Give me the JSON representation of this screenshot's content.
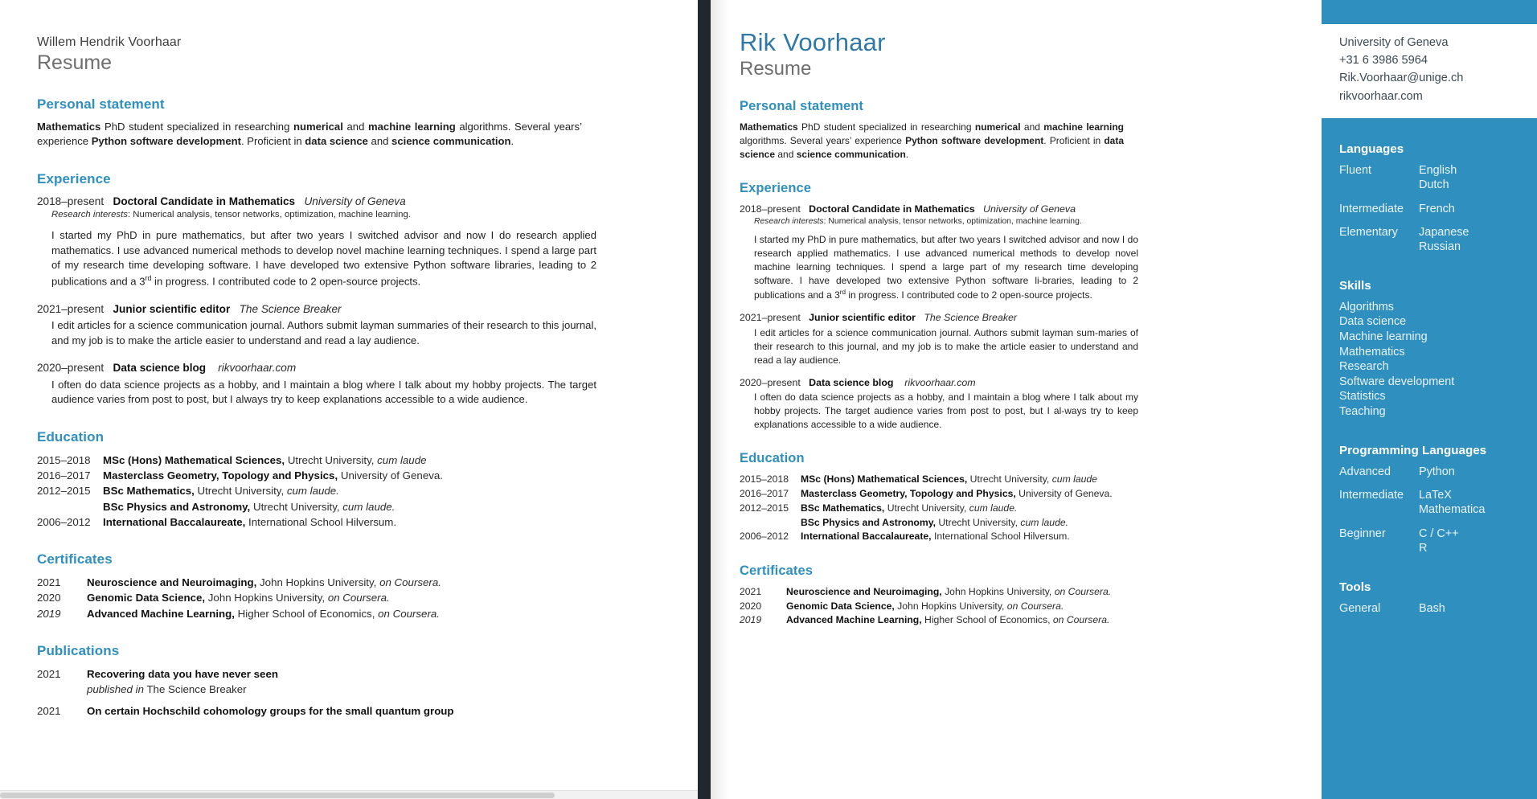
{
  "left_document": {
    "name_line": "Willem Hendrik Voorhaar",
    "title": "Resume",
    "sections": {
      "personal_statement": {
        "heading": "Personal statement",
        "paragraph_parts": [
          {
            "t": "Mathematics",
            "b": true
          },
          {
            "t": " PhD student specialized  in researching ",
            "b": false
          },
          {
            "t": "numerical",
            "b": true
          },
          {
            "t": " and ",
            "b": false
          },
          {
            "t": "machine  learning",
            "b": true
          },
          {
            "t": " algorithms. Several years’ experience ",
            "b": false
          },
          {
            "t": "Python  software  development",
            "b": true
          },
          {
            "t": ". Proficient in ",
            "b": false
          },
          {
            "t": "data science",
            "b": true
          },
          {
            "t": " and ",
            "b": false
          },
          {
            "t": "science communication",
            "b": true
          },
          {
            "t": ".",
            "b": false
          }
        ]
      },
      "experience": {
        "heading": "Experience",
        "entries": [
          {
            "years": "2018–present",
            "title": "Doctoral Candidate in Mathematics",
            "org": "University of Geneva",
            "meta_label": "Research interests",
            "meta_text": ": Numerical analysis, tensor networks, optimization, machine learning.",
            "body_1": "I started my PhD in pure mathematics, but after two years I switched advisor and now I do research applied mathematics. I use advanced numerical methods to develop  novel machine learning techniques. I spend a large part of my research time developing  software. I have developed  two extensive Python software libraries, leading to 2 publications and a 3",
            "body_sup": "rd",
            "body_2": " in progress. I contributed code to 2 open-source projects."
          },
          {
            "years": "2021–present",
            "title": "Junior scientific editor",
            "org": "The Science Breaker",
            "body_1": "I edit articles for a science communication journal. Authors submit layman summaries of their  research to this journal, and my job is to make the article easier to understand and read a lay audience."
          },
          {
            "years": "2020–present",
            "title": "Data science blog",
            "org": "rikvoorhaar.com",
            "body_1": "I often do data science projects as a hobby,  and I maintain a blog where I talk about my hobby projects. The target audience varies from post to post, but I always try to keep explanations  accessible to a wide audience."
          }
        ]
      },
      "education": {
        "heading": "Education",
        "rows": [
          {
            "years": "2015–2018",
            "degree": "MSc (Hons) Mathematical Sciences,",
            "inst": " Utrecht University,",
            "honors": "  cum laude"
          },
          {
            "years": "2016–2017",
            "degree": "Masterclass Geometry, Topology and Physics,",
            "inst": " University  of Geneva.",
            "honors": ""
          },
          {
            "years": "2012–2015",
            "degree": "BSc Mathematics,",
            "inst": " Utrecht University,",
            "honors": "  cum laude."
          },
          {
            "years": "",
            "degree": "BSc Physics and Astronomy,",
            "inst": " Utrecht University,",
            "honors": "  cum laude."
          },
          {
            "years": "2006–2012",
            "degree": "International Baccalaureate,",
            "inst": " International  School Hilversum.",
            "honors": ""
          }
        ]
      },
      "certificates": {
        "heading": "Certificates",
        "rows": [
          {
            "year": "2021",
            "italic_year": false,
            "name": "Neuroscience and Neuroimaging,",
            "inst": " John Hopkins University,",
            "via": "  on Coursera."
          },
          {
            "year": "2020",
            "italic_year": false,
            "name": "Genomic Data Science,",
            "inst": " John Hopkins University,",
            "via": " on Coursera."
          },
          {
            "year": "2019",
            "italic_year": true,
            "name": "Advanced Machine Learning,",
            "inst": " Higher School of Economics,",
            "via": " on Coursera."
          }
        ]
      },
      "publications": {
        "heading": "Publications",
        "rows": [
          {
            "year": "2021",
            "title": "Recovering data you have never seen",
            "sub_italic": "published in",
            "sub_rest": " The Science Breaker"
          },
          {
            "year": "2021",
            "title": "On certain Hochschild cohomology groups for the small quantum group",
            "sub_italic": "",
            "sub_rest": ""
          }
        ]
      }
    }
  },
  "right_document": {
    "name": "Rik Voorhaar",
    "title": "Resume",
    "sections": {
      "personal_statement": {
        "heading": "Personal statement",
        "paragraph_parts": [
          {
            "t": "Mathematics",
            "b": true
          },
          {
            "t": " PhD student specialized  in researching ",
            "b": false
          },
          {
            "t": "numerical",
            "b": true
          },
          {
            "t": " and ",
            "b": false
          },
          {
            "t": "machine learning",
            "b": true
          },
          {
            "t": " algorithms. Several years’ experience ",
            "b": false
          },
          {
            "t": "Python software development",
            "b": true
          },
          {
            "t": ". Proficient in ",
            "b": false
          },
          {
            "t": "data science",
            "b": true
          },
          {
            "t": " and ",
            "b": false
          },
          {
            "t": "science communication",
            "b": true
          },
          {
            "t": ".",
            "b": false
          }
        ]
      },
      "experience": {
        "heading": "Experience",
        "entries": [
          {
            "years": "2018–present",
            "title": "Doctoral Candidate in Mathematics",
            "org": "University of Geneva",
            "meta_label": "Research interests",
            "meta_text": ": Numerical analysis, tensor networks, optimization, machine learning.",
            "body_1": "I started my PhD in pure mathematics, but after two years I switched advisor and now I do research applied mathematics. I use advanced numerical methods to develop  novel machine learning techniques. I spend a large part of my research time developing  software. I have developed  two extensive  Python software li-braries, leading to 2 publications and a 3",
            "body_sup": "rd",
            "body_2": " in progress. I contributed code to 2 open-source projects."
          },
          {
            "years": "2021–present",
            "title": "Junior scientific editor",
            "org": "The Science Breaker",
            "body_1": "I edit articles for a science communication journal. Authors submit layman sum-maries of their research to this journal, and my job is to make the article easier to understand and read a lay audience."
          },
          {
            "years": "2020–present",
            "title": "Data science blog",
            "org": "rikvoorhaar.com",
            "body_1": "I often do data science projects as a hobby,  and I maintain a blog where I talk about my hobby projects. The target audience varies from post to post, but I al-ways try to keep explanations  accessible to a wide audience."
          }
        ]
      },
      "education": {
        "heading": "Education",
        "rows": [
          {
            "years": "2015–2018",
            "degree": "MSc (Hons) Mathematical Sciences,",
            "inst": " Utrecht University,",
            "honors": "  cum laude"
          },
          {
            "years": "2016–2017",
            "degree": "Masterclass Geometry, Topology and Physics,",
            "inst": " University of Geneva.",
            "honors": ""
          },
          {
            "years": "2012–2015",
            "degree": "BSc Mathematics,",
            "inst": " Utrecht University,",
            "honors": "  cum laude."
          },
          {
            "years": "",
            "degree": "BSc Physics and Astronomy,",
            "inst": " Utrecht University,",
            "honors": "  cum laude."
          },
          {
            "years": "2006–2012",
            "degree": "International Baccalaureate,",
            "inst": " International  School Hilversum.",
            "honors": ""
          }
        ]
      },
      "certificates": {
        "heading": "Certificates",
        "rows": [
          {
            "year": "2021",
            "italic_year": false,
            "name": "Neuroscience and Neuroimaging,",
            "inst": " John Hopkins University,",
            "via": "  on Coursera."
          },
          {
            "year": "2020",
            "italic_year": false,
            "name": "Genomic Data Science,",
            "inst": " John Hopkins University,",
            "via": "  on Coursera."
          },
          {
            "year": "2019",
            "italic_year": true,
            "name": "Advanced Machine Learning,",
            "inst": " Higher School of Economics,",
            "via": " on Coursera."
          }
        ]
      }
    }
  },
  "sidebar": {
    "contact": [
      "University of Geneva",
      "+31 6 3986 5964",
      "Rik.Voorhaar@unige.ch",
      "rikvoorhaar.com"
    ],
    "languages": {
      "heading": "Languages",
      "pairs": [
        {
          "level": "Fluent",
          "values": [
            "English",
            "Dutch"
          ]
        },
        {
          "level": "Intermediate",
          "values": [
            "French"
          ]
        },
        {
          "level": "Elementary",
          "values": [
            "Japanese",
            "Russian"
          ]
        }
      ]
    },
    "skills": {
      "heading": "Skills",
      "items": [
        "Algorithms",
        "Data science",
        "Machine learning",
        "Mathematics",
        "Research",
        "Software development",
        "Statistics",
        "Teaching"
      ]
    },
    "programming_languages": {
      "heading": "Programming Languages",
      "pairs": [
        {
          "level": "Advanced",
          "values": [
            "Python"
          ]
        },
        {
          "level": "Intermediate",
          "values": [
            "LaTeX",
            "Mathematica"
          ]
        },
        {
          "level": "Beginner",
          "values": [
            "C / C++",
            "R"
          ]
        }
      ]
    },
    "tools": {
      "heading": "Tools",
      "pairs": [
        {
          "level": "General",
          "values": [
            "Bash"
          ]
        }
      ]
    }
  },
  "colors": {
    "accent_blue": "#2f8fbe",
    "name_blue": "#2f78a8",
    "sidebar_bg": "#2f8fbe",
    "divider": "#22272e",
    "body_text": "#1f1f1f"
  }
}
